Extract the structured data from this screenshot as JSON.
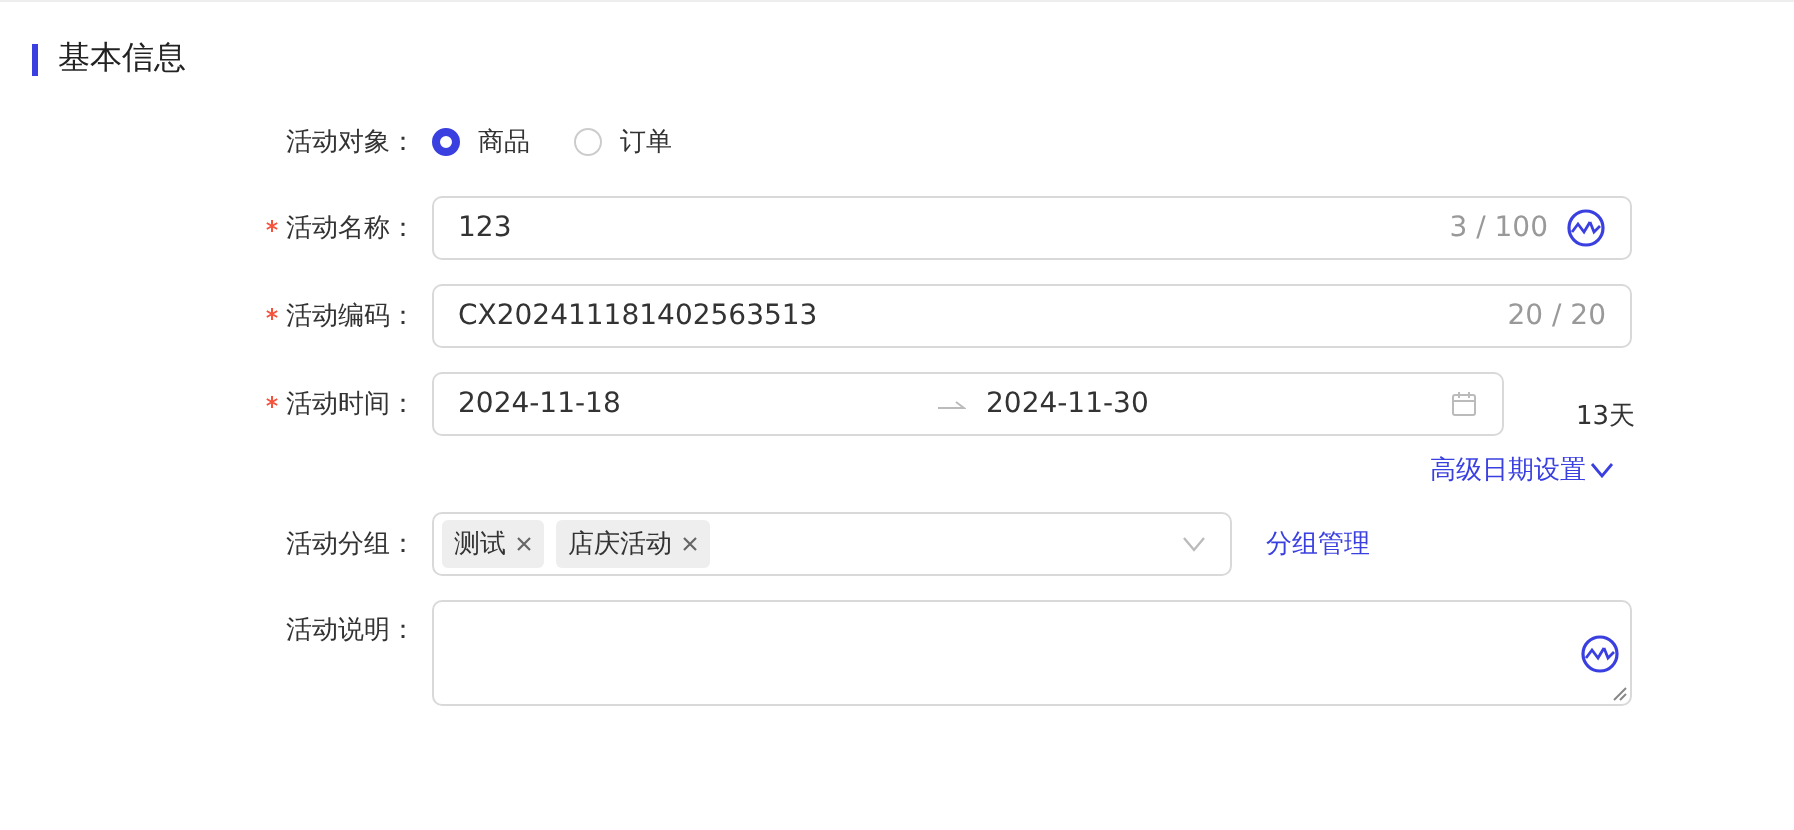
{
  "section": {
    "title": "基本信息"
  },
  "target": {
    "label": "活动对象：",
    "options": [
      {
        "label": "商品",
        "selected": true
      },
      {
        "label": "订单",
        "selected": false
      }
    ]
  },
  "name": {
    "label": "活动名称：",
    "required": true,
    "value": "123",
    "count": "3 / 100"
  },
  "code": {
    "label": "活动编码：",
    "required": true,
    "value": "CX202411181402563513",
    "count": "20 / 20"
  },
  "time": {
    "label": "活动时间：",
    "required": true,
    "start": "2024-11-18",
    "end": "2024-11-30",
    "days": "13天"
  },
  "advanced_link": {
    "label": "高级日期设置",
    "expanded": false
  },
  "group": {
    "label": "活动分组：",
    "tags": [
      "测试",
      "店庆活动"
    ],
    "manage_link": "分组管理"
  },
  "description": {
    "label": "活动说明："
  }
}
